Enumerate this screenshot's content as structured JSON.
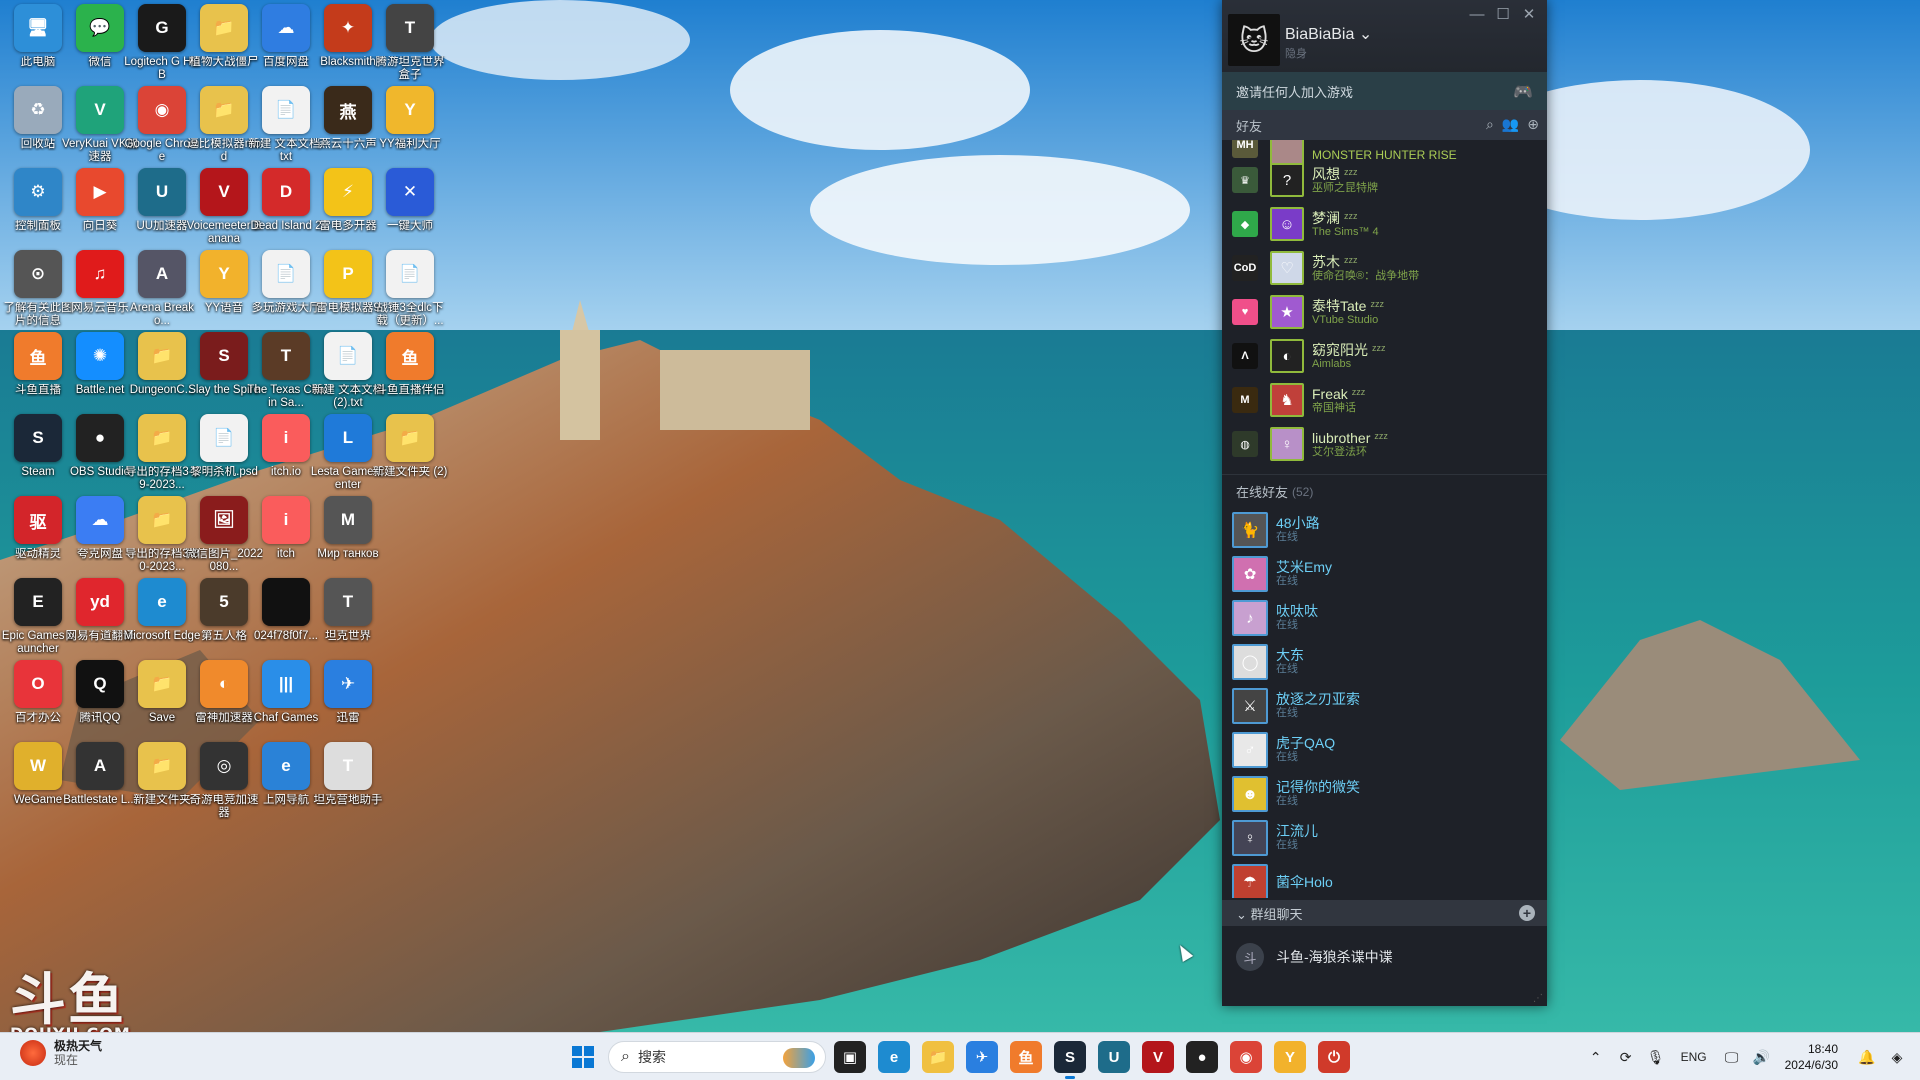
{
  "desktop": {
    "icons": [
      {
        "label": "此电脑",
        "glyph": "🖥",
        "color": "#2d8fd8",
        "col": 0,
        "row": 0
      },
      {
        "label": "微信",
        "glyph": "💬",
        "color": "#2bb24c",
        "col": 1,
        "row": 0
      },
      {
        "label": "Logitech G HUB",
        "glyph": "G",
        "color": "#1a1a1a",
        "col": 2,
        "row": 0
      },
      {
        "label": "植物大战僵尸",
        "glyph": "📁",
        "color": "#e8c24c",
        "col": 3,
        "row": 0
      },
      {
        "label": "百度网盘",
        "glyph": "☁",
        "color": "#2f7de1",
        "col": 4,
        "row": 0
      },
      {
        "label": "Blacksmith",
        "glyph": "✦",
        "color": "#c43b1b",
        "col": 5,
        "row": 0
      },
      {
        "label": "腾游坦克世界盒子",
        "glyph": "T",
        "color": "#444",
        "col": 6,
        "row": 0
      },
      {
        "label": "回收站",
        "glyph": "♻",
        "color": "#9ab",
        "col": 0,
        "row": 1
      },
      {
        "label": "VeryKuai VK加速器",
        "glyph": "V",
        "color": "#1fa37a",
        "col": 1,
        "row": 1
      },
      {
        "label": "Google Chrome",
        "glyph": "◉",
        "color": "#db4437",
        "col": 2,
        "row": 1
      },
      {
        "label": "逗比模拟器mod",
        "glyph": "📁",
        "color": "#e8c24c",
        "col": 3,
        "row": 1
      },
      {
        "label": "新建 文本文档.txt",
        "glyph": "📄",
        "color": "#f2f2f2",
        "col": 4,
        "row": 1
      },
      {
        "label": "燕云十六声",
        "glyph": "燕",
        "color": "#3a2a1a",
        "col": 5,
        "row": 1
      },
      {
        "label": "YY福利大厅",
        "glyph": "Y",
        "color": "#f0b72c",
        "col": 6,
        "row": 1
      },
      {
        "label": "控制面板",
        "glyph": "⚙",
        "color": "#2f86c8",
        "col": 0,
        "row": 2
      },
      {
        "label": "向日葵",
        "glyph": "▶",
        "color": "#e8492e",
        "col": 1,
        "row": 2
      },
      {
        "label": "UU加速器",
        "glyph": "U",
        "color": "#1e6c8a",
        "col": 2,
        "row": 2
      },
      {
        "label": "Voicemeeter Banana",
        "glyph": "V",
        "color": "#b4161b",
        "col": 3,
        "row": 2
      },
      {
        "label": "Dead Island 2",
        "glyph": "D",
        "color": "#d42a2a",
        "col": 4,
        "row": 2
      },
      {
        "label": "雷电多开器",
        "glyph": "⚡",
        "color": "#f3c318",
        "col": 5,
        "row": 2
      },
      {
        "label": "一键大师",
        "glyph": "✕",
        "color": "#2a5bd7",
        "col": 6,
        "row": 2
      },
      {
        "label": "了解有关此图片的信息",
        "glyph": "⊙",
        "color": "#555",
        "col": 0,
        "row": 3
      },
      {
        "label": "网易云音乐",
        "glyph": "♫",
        "color": "#e01b1b",
        "col": 1,
        "row": 3
      },
      {
        "label": "Arena Breako...",
        "glyph": "A",
        "color": "#556",
        "col": 2,
        "row": 3
      },
      {
        "label": "YY语音",
        "glyph": "Y",
        "color": "#f2b22c",
        "col": 3,
        "row": 3
      },
      {
        "label": "多玩游戏大厅",
        "glyph": "📄",
        "color": "#f2f2f2",
        "col": 4,
        "row": 3
      },
      {
        "label": "雷电模拟器9",
        "glyph": "P",
        "color": "#f3c318",
        "col": 5,
        "row": 3
      },
      {
        "label": "战锤3全dlc下载（更新）...",
        "glyph": "📄",
        "color": "#f2f2f2",
        "col": 6,
        "row": 3
      },
      {
        "label": "斗鱼直播",
        "glyph": "鱼",
        "color": "#f07b2c",
        "col": 0,
        "row": 4
      },
      {
        "label": "Battle.net",
        "glyph": "✺",
        "color": "#148eff",
        "col": 1,
        "row": 4
      },
      {
        "label": "DungeonC...",
        "glyph": "📁",
        "color": "#e8c24c",
        "col": 2,
        "row": 4
      },
      {
        "label": "Slay the Spire",
        "glyph": "S",
        "color": "#7a1c1c",
        "col": 3,
        "row": 4
      },
      {
        "label": "The Texas Chain Sa...",
        "glyph": "T",
        "color": "#5b3b26",
        "col": 4,
        "row": 4
      },
      {
        "label": "新建 文本文档 (2).txt",
        "glyph": "📄",
        "color": "#f2f2f2",
        "col": 5,
        "row": 4
      },
      {
        "label": "斗鱼直播伴侣",
        "glyph": "鱼",
        "color": "#f07b2c",
        "col": 6,
        "row": 4
      },
      {
        "label": "Steam",
        "glyph": "S",
        "color": "#1b2838",
        "col": 0,
        "row": 5
      },
      {
        "label": "OBS Studio",
        "glyph": "●",
        "color": "#222",
        "col": 1,
        "row": 5
      },
      {
        "label": "导出的存档3-29-2023...",
        "glyph": "📁",
        "color": "#e8c24c",
        "col": 2,
        "row": 5
      },
      {
        "label": "黎明杀机.psd",
        "glyph": "📄",
        "color": "#f2f2f2",
        "col": 3,
        "row": 5
      },
      {
        "label": "itch.io",
        "glyph": "i",
        "color": "#fa5c5c",
        "col": 4,
        "row": 5
      },
      {
        "label": "Lesta Game Center",
        "glyph": "L",
        "color": "#1f7ad9",
        "col": 5,
        "row": 5
      },
      {
        "label": "新建文件夹 (2)",
        "glyph": "📁",
        "color": "#e8c24c",
        "col": 6,
        "row": 5
      },
      {
        "label": "驱动精灵",
        "glyph": "驱",
        "color": "#d3252a",
        "col": 0,
        "row": 6
      },
      {
        "label": "夸克网盘",
        "glyph": "☁",
        "color": "#3b7df3",
        "col": 1,
        "row": 6
      },
      {
        "label": "导出的存档3-30-2023...",
        "glyph": "📁",
        "color": "#e8c24c",
        "col": 2,
        "row": 6
      },
      {
        "label": "微信图片_2022080...",
        "glyph": "🖼",
        "color": "#8a1c1c",
        "col": 3,
        "row": 6
      },
      {
        "label": "itch",
        "glyph": "i",
        "color": "#fa5c5c",
        "col": 4,
        "row": 6
      },
      {
        "label": "Мир танков",
        "glyph": "M",
        "color": "#555",
        "col": 5,
        "row": 6
      },
      {
        "label": "Epic Games Launcher",
        "glyph": "E",
        "color": "#222",
        "col": 0,
        "row": 7
      },
      {
        "label": "网易有道翻译",
        "glyph": "yd",
        "color": "#e0262d",
        "col": 1,
        "row": 7
      },
      {
        "label": "Microsoft Edge",
        "glyph": "e",
        "color": "#1e8bd0",
        "col": 2,
        "row": 7
      },
      {
        "label": "第五人格",
        "glyph": "5",
        "color": "#4b3b2b",
        "col": 3,
        "row": 7
      },
      {
        "label": "024f78f0f7...",
        "glyph": " ",
        "color": "#111",
        "col": 4,
        "row": 7
      },
      {
        "label": "坦克世界",
        "glyph": "T",
        "color": "#555",
        "col": 5,
        "row": 7
      },
      {
        "label": "百才办公",
        "glyph": "O",
        "color": "#e8343a",
        "col": 0,
        "row": 8
      },
      {
        "label": "腾讯QQ",
        "glyph": "Q",
        "color": "#111",
        "col": 1,
        "row": 8
      },
      {
        "label": "Save",
        "glyph": "📁",
        "color": "#e8c24c",
        "col": 2,
        "row": 8
      },
      {
        "label": "雷神加速器",
        "glyph": "◐",
        "color": "#f08a2c",
        "col": 3,
        "row": 8
      },
      {
        "label": "Chaf Games",
        "glyph": "|||",
        "color": "#2a8ee8",
        "col": 4,
        "row": 8
      },
      {
        "label": "迅雷",
        "glyph": "✈",
        "color": "#2a7fe0",
        "col": 5,
        "row": 8
      },
      {
        "label": "WeGame",
        "glyph": "W",
        "color": "#e0b02c",
        "col": 0,
        "row": 9
      },
      {
        "label": "Battlestate L...",
        "glyph": "A",
        "color": "#333",
        "col": 1,
        "row": 9
      },
      {
        "label": "新建文件夹",
        "glyph": "📁",
        "color": "#e8c24c",
        "col": 2,
        "row": 9
      },
      {
        "label": "奇游电竞加速器",
        "glyph": "◎",
        "color": "#333",
        "col": 3,
        "row": 9
      },
      {
        "label": "上网导航",
        "glyph": "e",
        "color": "#2a82d7",
        "col": 4,
        "row": 9
      },
      {
        "label": "坦克营地助手",
        "glyph": "T",
        "color": "#ddd",
        "col": 5,
        "row": 9
      }
    ],
    "watermark": "斗鱼",
    "watermark_sub": "DOUYU.COM"
  },
  "friends_window": {
    "user": {
      "name": "BiaBiaBia",
      "status": "隐身",
      "avatar_icon": "cat-avatar-icon"
    },
    "controls": {
      "minimize": "—",
      "maximize": "☐",
      "close": "✕"
    },
    "invite_label": "邀请任何人加入游戏",
    "search_bar_label": "好友",
    "in_game": [
      {
        "name": "",
        "game": "MONSTER HUNTER RISE",
        "game_color": "#5a5a3a",
        "avatar_color": "#a88",
        "game_glyph": "MH",
        "avatar_glyph": "",
        "zz": "",
        "partial": true
      },
      {
        "name": "风想",
        "game": "巫师之昆特牌",
        "game_color": "#3a5a3a",
        "avatar_color": "#222",
        "game_glyph": "♛",
        "avatar_glyph": "?",
        "zz": "zzz"
      },
      {
        "name": "梦澜",
        "game": "The Sims™ 4",
        "game_color": "#2fa84a",
        "avatar_color": "#7a3cc8",
        "game_glyph": "◆",
        "avatar_glyph": "☺",
        "zz": "zzz"
      },
      {
        "name": "苏木",
        "game": "使命召唤®：战争地带",
        "game_color": "#222",
        "avatar_color": "#cfd8e8",
        "game_glyph": "CoD",
        "avatar_glyph": "♡",
        "zz": "zzz"
      },
      {
        "name": "泰特Tate",
        "game": "VTube Studio",
        "game_color": "#f04f8a",
        "avatar_color": "#a05ad0",
        "game_glyph": "♥",
        "avatar_glyph": "★",
        "zz": "zzz"
      },
      {
        "name": "窈窕阳光",
        "game": "Aimlabs",
        "game_color": "#111",
        "avatar_color": "#222",
        "game_glyph": "Λ",
        "avatar_glyph": "◐",
        "zz": "zzz"
      },
      {
        "name": "Freak",
        "game": "帝国神话",
        "game_color": "#3a2a10",
        "avatar_color": "#c0403a",
        "game_glyph": "M",
        "avatar_glyph": "♞",
        "zz": "zzz"
      },
      {
        "name": "liubrother",
        "game": "艾尔登法环",
        "game_color": "#2e3a2a",
        "avatar_color": "#b890c8",
        "game_glyph": "◍",
        "avatar_glyph": "♀",
        "zz": "zzz"
      }
    ],
    "online_section": {
      "label": "在线好友",
      "count": "(52)"
    },
    "online": [
      {
        "name": "48小路",
        "status": "在线",
        "avatar_color": "#555",
        "avatar_glyph": "🐈"
      },
      {
        "name": "艾米Emy",
        "status": "在线",
        "avatar_color": "#d070b0",
        "avatar_glyph": "✿"
      },
      {
        "name": "呔呔呔",
        "status": "在线",
        "avatar_color": "#c8a0d0",
        "avatar_glyph": "♪"
      },
      {
        "name": "大东",
        "status": "在线",
        "avatar_color": "#ddd",
        "avatar_glyph": "◯"
      },
      {
        "name": "放逐之刃亚索",
        "status": "在线",
        "avatar_color": "#444",
        "avatar_glyph": "⚔"
      },
      {
        "name": "虎子QAQ",
        "status": "在线",
        "avatar_color": "#e8e8e8",
        "avatar_glyph": "♂"
      },
      {
        "name": "记得你的微笑",
        "status": "在线",
        "avatar_color": "#e0c030",
        "avatar_glyph": "☻"
      },
      {
        "name": "江流儿",
        "status": "在线",
        "avatar_color": "#445",
        "avatar_glyph": "♀"
      },
      {
        "name": "菌伞Holo",
        "status": "",
        "avatar_color": "#c04030",
        "avatar_glyph": "☂"
      }
    ],
    "group_header": "群组聊天",
    "group_chat": "斗鱼-海狼杀谍中谍"
  },
  "taskbar": {
    "weather_temp": "极热天气",
    "weather_note": "现在",
    "search_placeholder": "搜索",
    "apps": [
      {
        "name": "task-view-icon",
        "glyph": "▣",
        "color": "#222",
        "active": false
      },
      {
        "name": "edge-icon",
        "glyph": "e",
        "color": "#1e8bd0",
        "active": false
      },
      {
        "name": "file-explorer-icon",
        "glyph": "📁",
        "color": "#f0c040",
        "active": false
      },
      {
        "name": "xunlei-icon",
        "glyph": "✈",
        "color": "#2a7fe0",
        "active": false
      },
      {
        "name": "douyu-icon",
        "glyph": "鱼",
        "color": "#f07b2c",
        "active": false
      },
      {
        "name": "steam-icon",
        "glyph": "S",
        "color": "#1b2838",
        "active": true
      },
      {
        "name": "uu-icon",
        "glyph": "U",
        "color": "#1e6c8a",
        "active": false
      },
      {
        "name": "voicemeeter-icon",
        "glyph": "V",
        "color": "#b4161b",
        "active": false
      },
      {
        "name": "obs-icon",
        "glyph": "●",
        "color": "#222",
        "active": false
      },
      {
        "name": "chrome-icon",
        "glyph": "◉",
        "color": "#db4437",
        "active": false
      },
      {
        "name": "yy-icon",
        "glyph": "Y",
        "color": "#f2b22c",
        "active": false
      },
      {
        "name": "power-icon",
        "glyph": "⏻",
        "color": "#d03a2a",
        "active": false
      }
    ],
    "tray": {
      "lang": "ENG",
      "time": "18:40",
      "date": "2024/6/30"
    }
  }
}
